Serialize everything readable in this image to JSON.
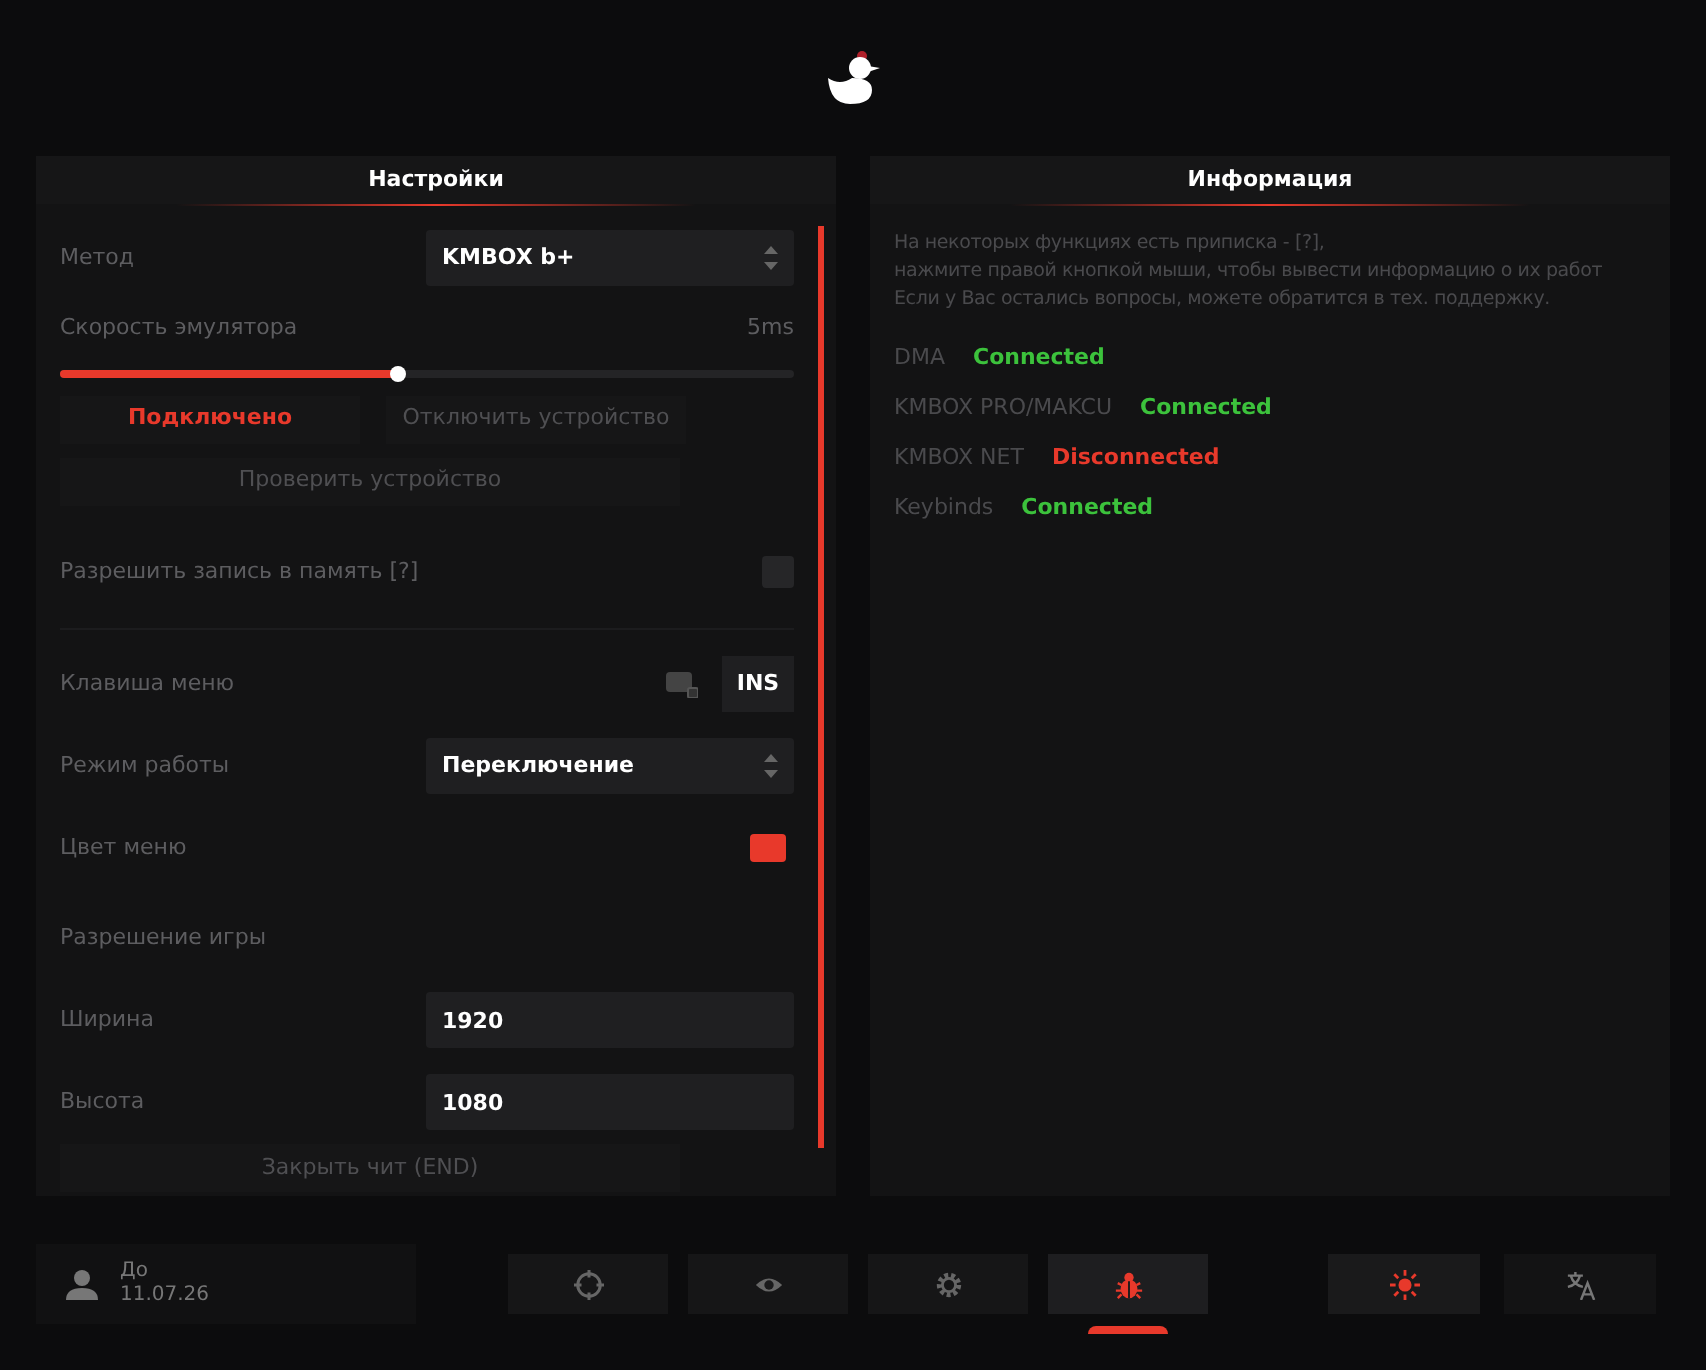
{
  "settings": {
    "title": "Настройки",
    "rows": [
      {
        "kind": "select",
        "label": "Метод",
        "value": "KMBOX b+"
      },
      {
        "kind": "slider",
        "label": "Скорость эмулятора",
        "reading": "5ms",
        "level": 0.46
      },
      {
        "kind": "buttons",
        "buttons": [
          {
            "label": "Подключено",
            "active": true
          },
          {
            "label": "Отключить устройство",
            "active": false
          }
        ]
      },
      {
        "kind": "wide_button",
        "label": "Проверить устройство"
      },
      {
        "kind": "checkbox",
        "label": "Разрешить запись в память [?]",
        "checked": false
      },
      {
        "kind": "key",
        "label": "Клавиша меню",
        "key": "INS"
      },
      {
        "kind": "select",
        "label": "Режим работы",
        "value": "Переключение"
      },
      {
        "kind": "color",
        "label": "Цвет меню",
        "color": "#e8392b"
      },
      {
        "kind": "heading",
        "label": "Разрешение игры"
      },
      {
        "kind": "input",
        "label": "Ширина",
        "value": "1920"
      },
      {
        "kind": "input",
        "label": "Высота",
        "value": "1080"
      },
      {
        "kind": "wide_button",
        "label": "Закрыть чит (END)"
      }
    ]
  },
  "info": {
    "title": "Информация",
    "note": [
      "На некоторых функциях есть приписка - [?],",
      "нажмите правой кнопкой мыши, чтобы вывести информацию о их работ",
      "Если у Вас остались вопросы, можете обратится в тех. поддержку."
    ],
    "statuses": [
      {
        "name": "DMA",
        "status": "Connected",
        "connected": true
      },
      {
        "name": "KMBOX PRO/MAKCU",
        "status": "Connected",
        "connected": true
      },
      {
        "name": "KMBOX NET",
        "status": "Disconnected",
        "connected": false
      },
      {
        "name": "Keybinds",
        "status": "Connected",
        "connected": true
      }
    ]
  },
  "footer": {
    "user": {
      "label": "До",
      "date": "11.07.26"
    },
    "tabs": [
      {
        "kind": "crosshair",
        "selected": false
      },
      {
        "kind": "eye",
        "selected": false
      },
      {
        "kind": "gear",
        "selected": false
      },
      {
        "kind": "bug",
        "selected": true
      }
    ],
    "tools": [
      {
        "kind": "sun"
      },
      {
        "kind": "translate"
      }
    ]
  }
}
